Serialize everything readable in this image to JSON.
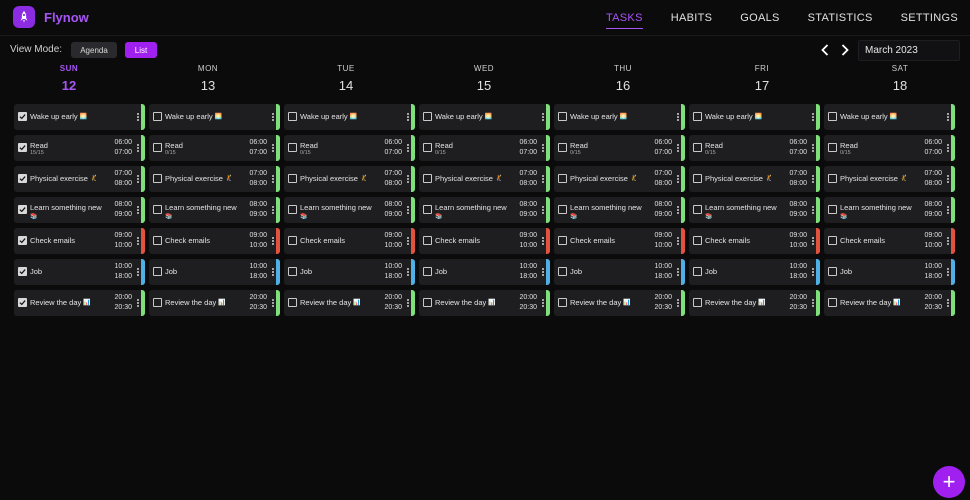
{
  "app": {
    "name": "Flynow"
  },
  "nav": {
    "items": [
      "TASKS",
      "HABITS",
      "GOALS",
      "STATISTICS",
      "SETTINGS"
    ],
    "active": "TASKS"
  },
  "view_mode": {
    "label": "View Mode:",
    "options": [
      "Agenda",
      "List"
    ],
    "selected": "List"
  },
  "calendar": {
    "month": "March 2023",
    "today_index": 0,
    "days": [
      {
        "name": "SUN",
        "num": "12"
      },
      {
        "name": "MON",
        "num": "13"
      },
      {
        "name": "TUE",
        "num": "14"
      },
      {
        "name": "WED",
        "num": "15"
      },
      {
        "name": "THU",
        "num": "16"
      },
      {
        "name": "FRI",
        "num": "17"
      },
      {
        "name": "SAT",
        "num": "18"
      }
    ]
  },
  "colors": {
    "accent": "#a855f7",
    "green": "#7ee07a",
    "red": "#e2533f",
    "blue": "#4fb0e6"
  },
  "tasks": [
    {
      "title": "Wake up early",
      "emoji": "🌅",
      "color": "green"
    },
    {
      "title": "Read",
      "start": "06:00",
      "end": "07:00",
      "color": "green",
      "progress": [
        "15/15",
        "0/15",
        "0/15",
        "0/15",
        "0/15",
        "0/15",
        "0/15"
      ]
    },
    {
      "title": "Physical exercise",
      "emoji": "🤾",
      "start": "07:00",
      "end": "08:00",
      "color": "green"
    },
    {
      "title": "Learn something new",
      "emoji": "📚",
      "start": "08:00",
      "end": "09:00",
      "color": "green"
    },
    {
      "title": "Check emails",
      "start": "09:00",
      "end": "10:00",
      "color": "red"
    },
    {
      "title": "Job",
      "start": "10:00",
      "end": "18:00",
      "color": "blue"
    },
    {
      "title": "Review the day",
      "emoji": "📊",
      "start": "20:00",
      "end": "20:30",
      "color": "green"
    }
  ],
  "completed_day_index": 0,
  "fab_label": "+"
}
